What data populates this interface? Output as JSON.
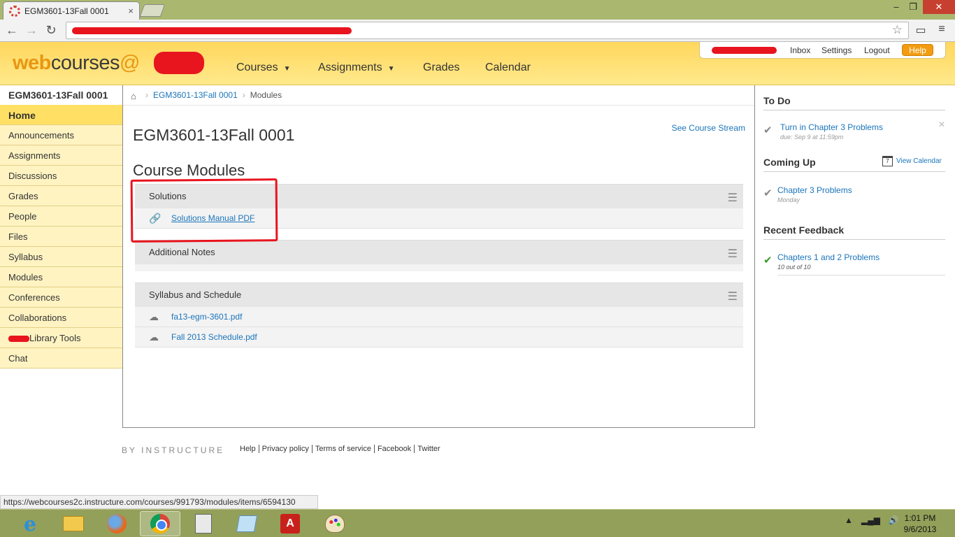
{
  "browser": {
    "tab_title": "EGM3601-13Fall 0001",
    "tab_close": "×",
    "window_min": "–",
    "window_max": "❐",
    "window_close": "✕"
  },
  "header": {
    "logo_web": "web",
    "logo_courses": "courses",
    "logo_at": "@",
    "nav": {
      "courses": "Courses",
      "assignments": "Assignments",
      "grades": "Grades",
      "calendar": "Calendar"
    },
    "user_links": {
      "inbox": "Inbox",
      "settings": "Settings",
      "logout": "Logout",
      "help": "Help"
    }
  },
  "sidebar": {
    "course_title": "EGM3601-13Fall 0001",
    "items": [
      {
        "label": "Home",
        "active": true
      },
      {
        "label": "Announcements"
      },
      {
        "label": "Assignments"
      },
      {
        "label": "Discussions"
      },
      {
        "label": "Grades"
      },
      {
        "label": "People"
      },
      {
        "label": "Files"
      },
      {
        "label": "Syllabus"
      },
      {
        "label": "Modules"
      },
      {
        "label": "Conferences"
      },
      {
        "label": "Collaborations"
      },
      {
        "label": "Library Tools"
      },
      {
        "label": "Chat"
      }
    ]
  },
  "breadcrumb": {
    "course": "EGM3601-13Fall 0001",
    "page": "Modules"
  },
  "main": {
    "title": "EGM3601-13Fall 0001",
    "stream_link": "See Course Stream",
    "modules_title": "Course Modules",
    "modules": [
      {
        "name": "Solutions",
        "items": [
          {
            "label": "Solutions Manual PDF",
            "icon": "link-icon"
          }
        ]
      },
      {
        "name": "Additional Notes",
        "items": []
      },
      {
        "name": "Syllabus and Schedule",
        "items": [
          {
            "label": "fa13-egm-3601.pdf",
            "icon": "download-icon"
          },
          {
            "label": "Fall 2013 Schedule.pdf",
            "icon": "download-icon"
          }
        ]
      }
    ]
  },
  "right": {
    "todo_head": "To Do",
    "todo_item_title": "Turn in Chapter 3 Problems",
    "todo_item_sub": "due: Sep 9 at 11:59pm",
    "coming_head": "Coming Up",
    "view_calendar": "View Calendar",
    "calendar_icon_day": "7",
    "coming_item_title": "Chapter 3 Problems",
    "coming_item_sub": "Monday",
    "feedback_head": "Recent Feedback",
    "feedback_item_title": "Chapters 1 and 2 Problems",
    "feedback_item_sub": "10 out of 10"
  },
  "footer": {
    "brand": "BY INSTRUCTURE",
    "links": [
      "Help",
      "Privacy policy",
      "Terms of service",
      "Facebook",
      "Twitter"
    ]
  },
  "status_url": "https://webcourses2c.instructure.com/courses/991793/modules/items/6594130",
  "taskbar": {
    "time": "1:01 PM",
    "date": "9/6/2013"
  },
  "colors": {
    "header_yellow": "#ffd75c",
    "link_blue": "#1b75bb",
    "help_orange": "#f39c12",
    "annotation_red": "#e8141e"
  }
}
